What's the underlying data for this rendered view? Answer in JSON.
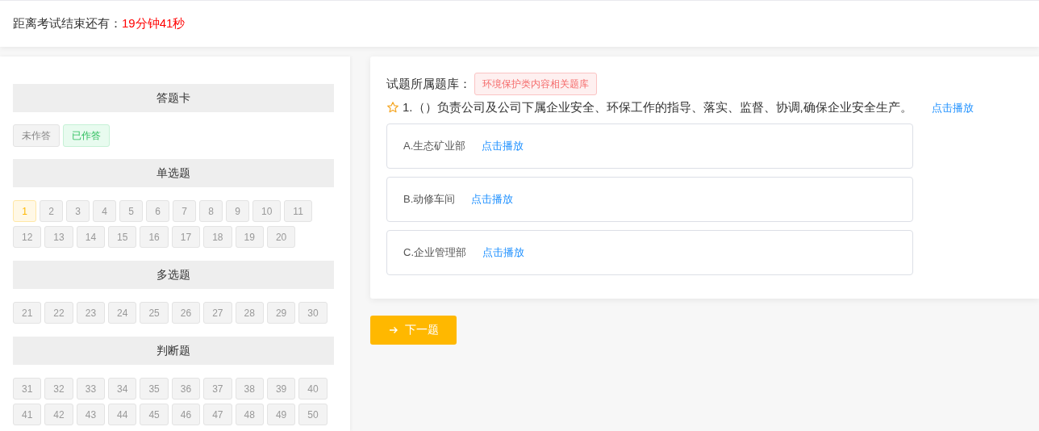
{
  "timer": {
    "label": "距离考试结束还有：",
    "remaining": "19分钟41秒"
  },
  "answer_card": {
    "title": "答题卡",
    "legend": [
      {
        "kind": "unanswered",
        "label": "未作答"
      },
      {
        "kind": "answered",
        "label": "已作答"
      }
    ],
    "sections": [
      {
        "title": "单选题",
        "numbers": [
          {
            "label": "1",
            "selected": true
          },
          {
            "label": "2",
            "selected": false
          },
          {
            "label": "3",
            "selected": false
          },
          {
            "label": "4",
            "selected": false
          },
          {
            "label": "5",
            "selected": false
          },
          {
            "label": "6",
            "selected": false
          },
          {
            "label": "7",
            "selected": false
          },
          {
            "label": "8",
            "selected": false
          },
          {
            "label": "9",
            "selected": false
          },
          {
            "label": "10",
            "selected": false
          },
          {
            "label": "11",
            "selected": false
          },
          {
            "label": "12",
            "selected": false
          },
          {
            "label": "13",
            "selected": false
          },
          {
            "label": "14",
            "selected": false
          },
          {
            "label": "15",
            "selected": false
          },
          {
            "label": "16",
            "selected": false
          },
          {
            "label": "17",
            "selected": false
          },
          {
            "label": "18",
            "selected": false
          },
          {
            "label": "19",
            "selected": false
          },
          {
            "label": "20",
            "selected": false
          }
        ]
      },
      {
        "title": "多选题",
        "numbers": [
          {
            "label": "21",
            "selected": false
          },
          {
            "label": "22",
            "selected": false
          },
          {
            "label": "23",
            "selected": false
          },
          {
            "label": "24",
            "selected": false
          },
          {
            "label": "25",
            "selected": false
          },
          {
            "label": "26",
            "selected": false
          },
          {
            "label": "27",
            "selected": false
          },
          {
            "label": "28",
            "selected": false
          },
          {
            "label": "29",
            "selected": false
          },
          {
            "label": "30",
            "selected": false
          }
        ]
      },
      {
        "title": "判断题",
        "numbers": [
          {
            "label": "31",
            "selected": false
          },
          {
            "label": "32",
            "selected": false
          },
          {
            "label": "33",
            "selected": false
          },
          {
            "label": "34",
            "selected": false
          },
          {
            "label": "35",
            "selected": false
          },
          {
            "label": "36",
            "selected": false
          },
          {
            "label": "37",
            "selected": false
          },
          {
            "label": "38",
            "selected": false
          },
          {
            "label": "39",
            "selected": false
          },
          {
            "label": "40",
            "selected": false
          },
          {
            "label": "41",
            "selected": false
          },
          {
            "label": "42",
            "selected": false
          },
          {
            "label": "43",
            "selected": false
          },
          {
            "label": "44",
            "selected": false
          },
          {
            "label": "45",
            "selected": false
          },
          {
            "label": "46",
            "selected": false
          },
          {
            "label": "47",
            "selected": false
          },
          {
            "label": "48",
            "selected": false
          },
          {
            "label": "49",
            "selected": false
          },
          {
            "label": "50",
            "selected": false
          }
        ]
      }
    ]
  },
  "question": {
    "bank_label": "试题所属题库：",
    "bank_tag": "环境保护类内容相关题库",
    "starred": false,
    "text": "1.（）负责公司及公司下属企业安全、环保工作的指导、落实、监督、协调,确保企业安全生产。",
    "play_link": "点击播放",
    "options": [
      {
        "label": "A.生态矿业部",
        "play_link": "点击播放",
        "selected": false
      },
      {
        "label": "B.动修车间",
        "play_link": "点击播放",
        "selected": false
      },
      {
        "label": "C.企业管理部",
        "play_link": "点击播放",
        "selected": false
      }
    ]
  },
  "next_button": {
    "label": "下一题"
  }
}
